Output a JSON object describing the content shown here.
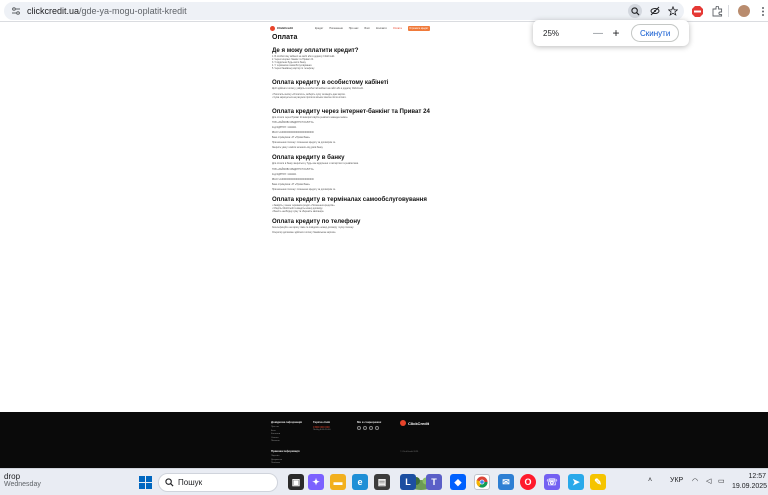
{
  "browser": {
    "url_domain": "clickcredit.ua",
    "url_path": "/gde-ya-mogu-oplatit-kredit",
    "zoom": {
      "value": "25%",
      "minus": "—",
      "plus": "+",
      "reset_label": "Скинути"
    },
    "colors": {
      "accent": "#0b57d0"
    }
  },
  "site": {
    "brand": "ClickCredit",
    "nav": [
      "Кредит",
      "Погашення",
      "Про нас",
      "Блог",
      "Контакти",
      "Оплата"
    ],
    "nav_active": "Оплата",
    "nav_button": "Отримати кредит",
    "colors": {
      "brand": "#e8442b",
      "button": "#f07a3a"
    }
  },
  "article": {
    "title": "Оплата",
    "sections": [
      {
        "heading": "Де я можу оплатити кредит?",
        "items": [
          "1. В особистому кабінеті на сайті або в додатку ClickCredit.",
          "2. Через інтернет-банкінг та Приват 24.",
          "3. У відділенні будь-якого банку.",
          "4. У терміналах самообслуговування.",
          "5. Через банківську картку по телефону."
        ]
      },
      {
        "heading": "Оплата кредиту в особистому кабінеті",
        "items": [
          "Щоб здійснити оплату, увійдіть в особистий кабінет на сайті або в додатку ClickCredit.",
          "Натисніть кнопку «Оплатити», виберіть суму та введіть дані картки.",
          "Сума зарахується на рахунок протягом кількох хвилин після оплати."
        ]
      },
      {
        "heading": "Оплата кредиту через інтернет-банкінг та Приват 24",
        "items": [
          "Для оплати через Приват 24 використовуйте реквізити наведені нижче.",
          "ТОВ «ЗАЙМОВІ КРЕДИТНІ ПОСЛУГИ»",
          "Код ЄДРПОУ: 11111111",
          "IBAN: UA0000000000000000000000000",
          "Банк отримувача: АТ «Приватбанк»",
          "Призначення платежу: погашення кредиту за договором №.",
          "Зверніть увагу: комісія залежить від умов банку."
        ]
      },
      {
        "heading": "Оплата кредиту в банку",
        "items": [
          "Для оплати в банку зверніться у будь-яке відділення з паспортом та реквізитами.",
          "ТОВ «ЗАЙМОВІ КРЕДИТНІ ПОСЛУГИ»",
          "Код ЄДРПОУ: 11111111",
          "IBAN: UA0000000000000000000000000",
          "Банк отримувача: АТ «Приватбанк»",
          "Призначення платежу: погашення кредиту за договором №."
        ]
      },
      {
        "heading": "Оплата кредиту в терміналах самообслуговування",
        "items": [
          "Знайдіть у меню термінала розділ «Погашення кредитів».",
          "Оберіть ClickCredit та введіть номер договору.",
          "Внесіть необхідну суму та збережіть квитанцію."
        ]
      },
      {
        "heading": "Оплата кредиту по телефону",
        "items": [
          "Зателефонуйте на гарячу лінію та повідомте номер договору і суму платежу.",
          "Оператор допоможе здійснити оплату банківською карткою."
        ]
      }
    ]
  },
  "footer": {
    "col1": {
      "heading": "Довідкова інформація",
      "links": [
        "Про нас",
        "Блог",
        "Контакти",
        "Оплата",
        "Питання"
      ]
    },
    "col2": {
      "heading": "Гаряча лінія",
      "phone": "0 800 000 000",
      "hours": "Пн-Нд 8:00-20:00"
    },
    "col3": {
      "heading": "Ми в соцмережах"
    },
    "col4": {
      "heading": "Правова інформація",
      "links": [
        "Ліцензія",
        "Документи",
        "Політика"
      ]
    },
    "brand": "ClickCredit",
    "copyright": "© ClickCredit 2025"
  },
  "taskbar": {
    "weather_title": "drop",
    "weather_sub": "Wednesday",
    "search_label": "Пошук",
    "lang": "УКР",
    "time": "12:57",
    "date": "19.09.2025"
  }
}
